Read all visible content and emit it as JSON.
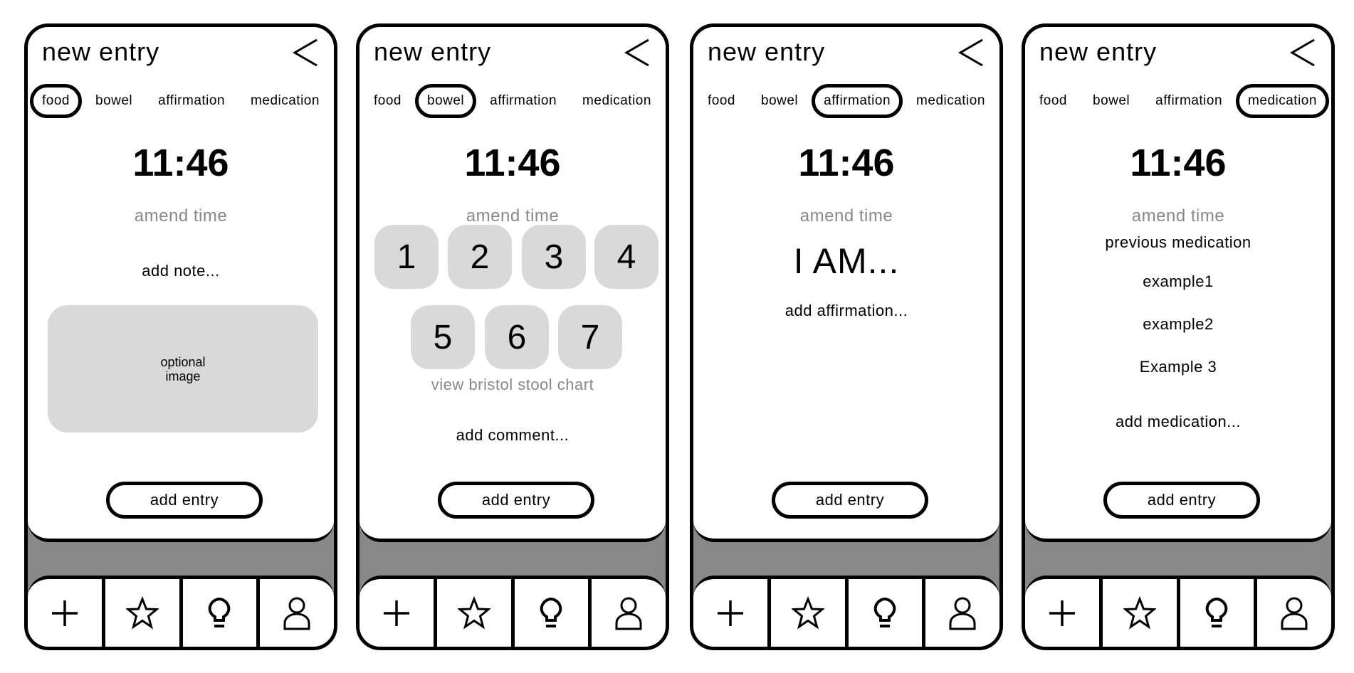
{
  "common": {
    "title": "new entry",
    "time": "11:46",
    "amend": "amend time",
    "add_entry": "add entry",
    "tabs": [
      "food",
      "bowel",
      "affirmation",
      "medication"
    ],
    "nav": [
      "plus-icon",
      "star-icon",
      "lightbulb-icon",
      "user-icon"
    ]
  },
  "food": {
    "note": "add note...",
    "image_l1": "optional",
    "image_l2": "image"
  },
  "bowel": {
    "scale": [
      "1",
      "2",
      "3",
      "4",
      "5",
      "6",
      "7"
    ],
    "chart_link": "view bristol stool chart",
    "comment": "add comment..."
  },
  "affirmation": {
    "heading": "I AM...",
    "placeholder": "add affirmation..."
  },
  "medication": {
    "heading": "previous medication",
    "items": [
      "example1",
      "example2",
      "Example 3"
    ],
    "placeholder": "add medication..."
  },
  "colors": {
    "tile": "#d9d9d9",
    "band": "#888888",
    "muted": "#888888"
  }
}
